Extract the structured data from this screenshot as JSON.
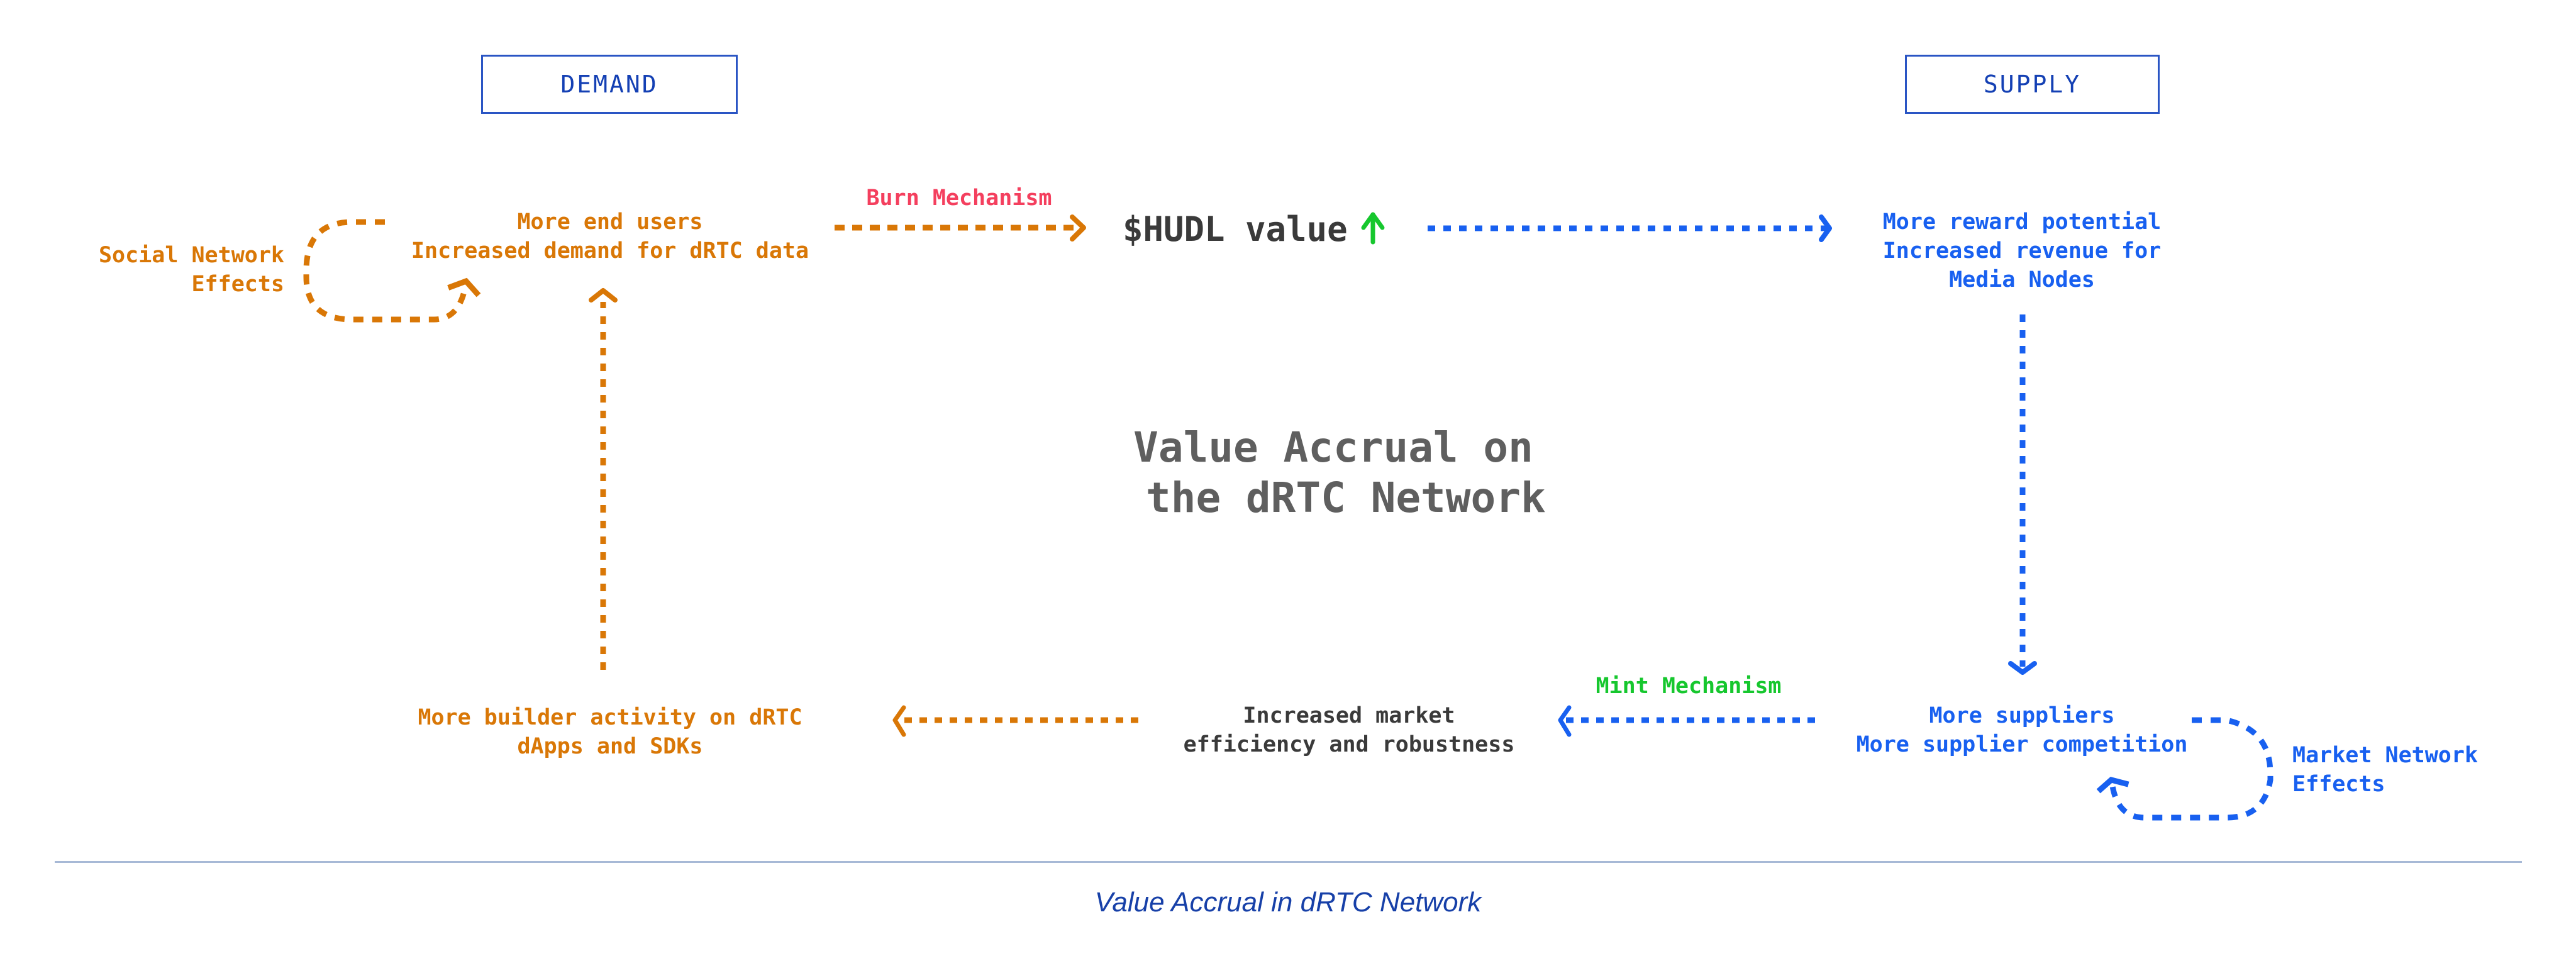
{
  "headers": {
    "demand": "DEMAND",
    "supply": "SUPPLY"
  },
  "demand_side": {
    "social_effects": "Social Network\nEffects",
    "end_users": "More end users\nIncreased demand for dRTC data",
    "builder_activity": "More builder activity on dRTC\ndApps and SDKs"
  },
  "mechanisms": {
    "burn": "Burn Mechanism",
    "mint": "Mint Mechanism"
  },
  "token": {
    "value_label": "$HUDL value",
    "trend_icon": "arrow-up-icon"
  },
  "supply_side": {
    "reward": "More reward potential\nIncreased revenue for\nMedia Nodes",
    "suppliers": "More suppliers\nMore supplier competition",
    "market_effects": "Market Network\nEffects"
  },
  "market": {
    "efficiency": "Increased market\nefficiency and robustness"
  },
  "center_title": "Value Accrual on\n the dRTC Network",
  "caption": "Value Accrual in dRTC Network",
  "colors": {
    "demand": "#d97706",
    "supply": "#1860f0",
    "burn": "#f43f5e",
    "mint": "#16c72e",
    "header_border": "#2a55c4",
    "title": "#5f5f5f",
    "divider": "#a7b9d6",
    "caption": "#1740a8"
  }
}
